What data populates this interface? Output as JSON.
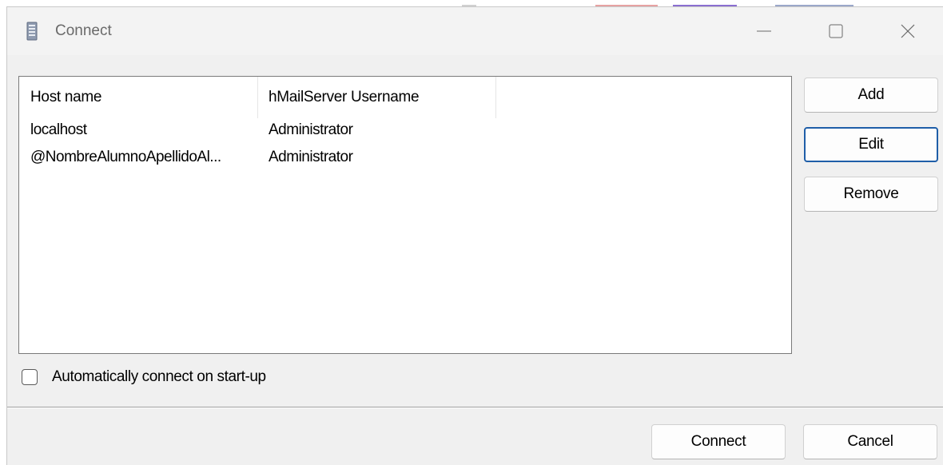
{
  "window": {
    "title": "Connect"
  },
  "server_list": {
    "columns": [
      "Host name",
      "hMailServer Username",
      ""
    ],
    "rows": [
      {
        "host": "localhost",
        "username": "Administrator"
      },
      {
        "host": "@NombreAlumnoApellidoAl...",
        "username": "Administrator"
      }
    ]
  },
  "side_buttons": {
    "add": "Add",
    "edit": "Edit",
    "remove": "Remove"
  },
  "options": {
    "auto_connect_label": "Automatically connect on start-up",
    "auto_connect_checked": false
  },
  "footer": {
    "connect": "Connect",
    "cancel": "Cancel"
  },
  "colors": {
    "accent": "#1f5ea8",
    "window_bg": "#f0f0f0"
  },
  "icons": {
    "app": "server-icon",
    "minimize": "minimize-icon",
    "maximize": "maximize-icon",
    "close": "close-icon"
  }
}
